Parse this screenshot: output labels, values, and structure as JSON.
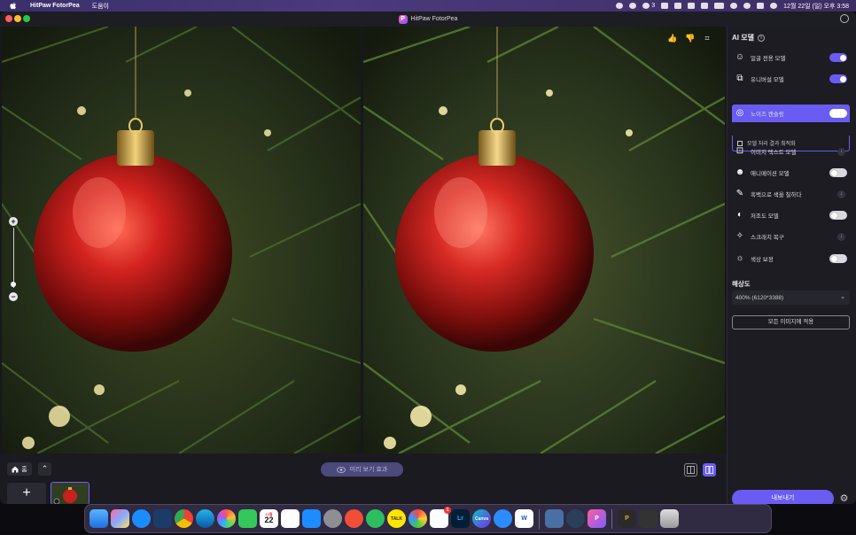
{
  "menubar": {
    "app_name": "HitPaw FotorPea",
    "menu_help": "도움이",
    "badge_count": "3",
    "datetime": "12월 22일 (일) 오후 3:58"
  },
  "window": {
    "title": "HitPaw FotorPea",
    "logo_letter": "P"
  },
  "bottom": {
    "home_label": "홈",
    "preview_label": "미리 보기 효과",
    "add_symbol": "+"
  },
  "panel": {
    "title": "AI 모델",
    "models": [
      {
        "label": "얼굴 전용 모델",
        "control": "toggle",
        "state": "on"
      },
      {
        "label": "유니버설 모델",
        "control": "toggle",
        "state": "on"
      },
      {
        "label": "노이즈 캔슬링",
        "control": "toggle",
        "state": "on",
        "active": true
      },
      {
        "label": "이미지 텍스트 모델",
        "control": "download"
      },
      {
        "label": "애니메이션 모델",
        "control": "toggle",
        "state": "off"
      },
      {
        "label": "흑백으로 색을 칠하다",
        "control": "download"
      },
      {
        "label": "저조도 모델",
        "control": "toggle",
        "state": "off"
      },
      {
        "label": "스크래치 복구",
        "control": "download"
      },
      {
        "label": "색상 보정",
        "control": "toggle",
        "state": "off"
      }
    ],
    "sub_option": "모델 처리 결과 최적화",
    "resolution_title": "해상도",
    "resolution_value": "400% (6120*3388)",
    "apply_all": "모든 이미지에 적용",
    "export": "내보내기"
  },
  "dock": {
    "calendar_month": "12월",
    "calendar_day": "22",
    "talk_label": "TALK",
    "lr_label": "Lr",
    "canva_label": "Canva",
    "word_label": "W",
    "p_label": "P",
    "notification_badge": "1"
  },
  "colors": {
    "accent": "#6a5cf2",
    "panel_bg": "#1c1c22",
    "window_bg": "#17171d"
  }
}
